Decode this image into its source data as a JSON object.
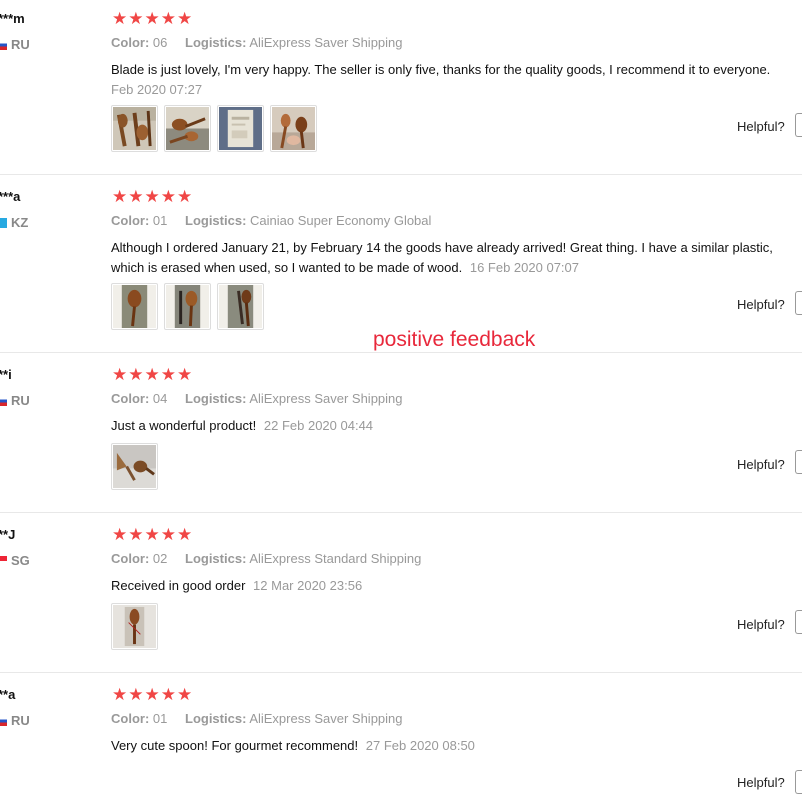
{
  "colors": {
    "star": "#f04645",
    "annotation": "#e8283b",
    "muted": "#999999"
  },
  "annotation": "positive feedback",
  "reviews": [
    {
      "user": "***m",
      "country": "RU",
      "flag": "ru",
      "stars": "★★★★★",
      "color_label": "Color:",
      "color": "06",
      "logistics_label": "Logistics:",
      "logistics": "AliExpress Saver Shipping",
      "text": "Blade is just lovely, I'm very happy. The seller is only five, thanks for the quality goods, I recommend it to everyone.",
      "date": "Feb 2020 07:27",
      "photos": [
        "spoons-on-cloth-photo",
        "spoons-on-table-photo",
        "package-bag-photo",
        "spoon-in-hand-photo"
      ],
      "helpful": "Helpful?"
    },
    {
      "user": "***a",
      "country": "KZ",
      "flag": "kz",
      "stars": "★★★★★",
      "color_label": "Color:",
      "color": "01",
      "logistics_label": "Logistics:",
      "logistics": "Cainiao Super Economy Global",
      "text": "Although I ordered January 21, by February 14 the goods have already arrived! Great thing. I have a similar plastic, which is erased when used, so I wanted to be made of wood.",
      "date": "16 Feb 2020 07:07",
      "photos": [
        "spoon-front-photo",
        "spoon-side-photo",
        "spoon-angle-photo"
      ],
      "helpful": "Helpful?"
    },
    {
      "user": "**i",
      "country": "RU",
      "flag": "ru",
      "stars": "★★★★★",
      "color_label": "Color:",
      "color": "04",
      "logistics_label": "Logistics:",
      "logistics": "AliExpress Saver Shipping",
      "text": "Just a wonderful product!",
      "date": "22 Feb 2020 04:44",
      "photos": [
        "two-spoons-photo"
      ],
      "helpful": "Helpful?"
    },
    {
      "user": "**J",
      "country": "SG",
      "flag": "sg",
      "stars": "★★★★★",
      "color_label": "Color:",
      "color": "02",
      "logistics_label": "Logistics:",
      "logistics": "AliExpress Standard Shipping",
      "text": "Received in good order",
      "date": "12 Mar 2020 23:56",
      "photos": [
        "spoon-in-package-photo"
      ],
      "helpful": "Helpful?"
    },
    {
      "user": "**a",
      "country": "RU",
      "flag": "ru",
      "stars": "★★★★★",
      "color_label": "Color:",
      "color": "01",
      "logistics_label": "Logistics:",
      "logistics": "AliExpress Saver Shipping",
      "text": "Very cute spoon! For gourmet recommend!",
      "date": "27 Feb 2020 08:50",
      "photos": [],
      "helpful": "Helpful?"
    }
  ]
}
